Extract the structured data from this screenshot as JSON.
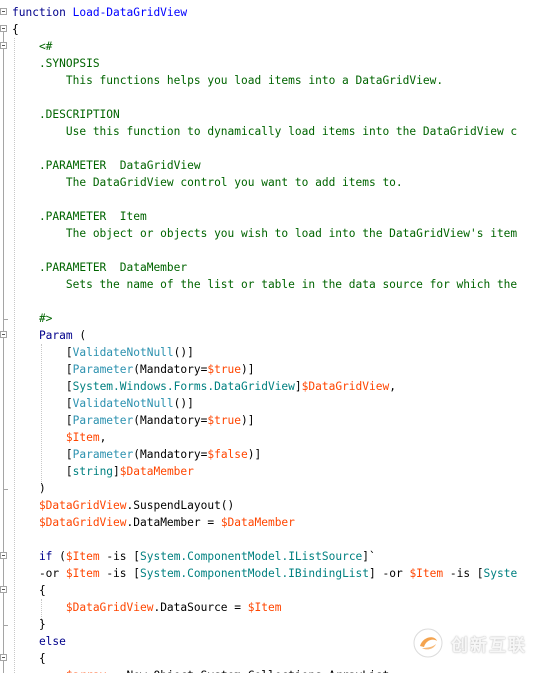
{
  "editor": {
    "lines": [
      [
        {
          "c": "kw",
          "t": "function "
        },
        {
          "c": "fn",
          "t": "Load-DataGridView"
        }
      ],
      [
        {
          "c": "txt",
          "t": "{"
        }
      ],
      [
        {
          "c": "cmt",
          "t": "    <#"
        }
      ],
      [
        {
          "c": "cmt",
          "t": "    .SYNOPSIS"
        }
      ],
      [
        {
          "c": "cmt",
          "t": "        This functions helps you load items into a DataGridView."
        }
      ],
      [
        {
          "c": "txt",
          "t": ""
        }
      ],
      [
        {
          "c": "cmt",
          "t": "    .DESCRIPTION"
        }
      ],
      [
        {
          "c": "cmt",
          "t": "        Use this function to dynamically load items into the DataGridView c"
        }
      ],
      [
        {
          "c": "txt",
          "t": ""
        }
      ],
      [
        {
          "c": "cmt",
          "t": "    .PARAMETER  DataGridView"
        }
      ],
      [
        {
          "c": "cmt",
          "t": "        The DataGridView control you want to add items to."
        }
      ],
      [
        {
          "c": "txt",
          "t": ""
        }
      ],
      [
        {
          "c": "cmt",
          "t": "    .PARAMETER  Item"
        }
      ],
      [
        {
          "c": "cmt",
          "t": "        The object or objects you wish to load into the DataGridView's item"
        }
      ],
      [
        {
          "c": "txt",
          "t": ""
        }
      ],
      [
        {
          "c": "cmt",
          "t": "    .PARAMETER  DataMember"
        }
      ],
      [
        {
          "c": "cmt",
          "t": "        Sets the name of the list or table in the data source for which the"
        }
      ],
      [
        {
          "c": "txt",
          "t": ""
        }
      ],
      [
        {
          "c": "cmt",
          "t": "    #>"
        }
      ],
      [
        {
          "c": "kw",
          "t": "    Param "
        },
        {
          "c": "txt",
          "t": "("
        }
      ],
      [
        {
          "c": "txt",
          "t": "        ["
        },
        {
          "c": "attr",
          "t": "ValidateNotNull"
        },
        {
          "c": "txt",
          "t": "()]"
        }
      ],
      [
        {
          "c": "txt",
          "t": "        ["
        },
        {
          "c": "attr",
          "t": "Parameter"
        },
        {
          "c": "txt",
          "t": "(Mandatory="
        },
        {
          "c": "var",
          "t": "$true"
        },
        {
          "c": "txt",
          "t": ")]"
        }
      ],
      [
        {
          "c": "txt",
          "t": "        ["
        },
        {
          "c": "typ",
          "t": "System.Windows.Forms.DataGridView"
        },
        {
          "c": "txt",
          "t": "]"
        },
        {
          "c": "var",
          "t": "$DataGridView"
        },
        {
          "c": "txt",
          "t": ","
        }
      ],
      [
        {
          "c": "txt",
          "t": "        ["
        },
        {
          "c": "attr",
          "t": "ValidateNotNull"
        },
        {
          "c": "txt",
          "t": "()]"
        }
      ],
      [
        {
          "c": "txt",
          "t": "        ["
        },
        {
          "c": "attr",
          "t": "Parameter"
        },
        {
          "c": "txt",
          "t": "(Mandatory="
        },
        {
          "c": "var",
          "t": "$true"
        },
        {
          "c": "txt",
          "t": ")]"
        }
      ],
      [
        {
          "c": "var",
          "t": "        $Item"
        },
        {
          "c": "txt",
          "t": ","
        }
      ],
      [
        {
          "c": "txt",
          "t": "        ["
        },
        {
          "c": "attr",
          "t": "Parameter"
        },
        {
          "c": "txt",
          "t": "(Mandatory="
        },
        {
          "c": "var",
          "t": "$false"
        },
        {
          "c": "txt",
          "t": ")]"
        }
      ],
      [
        {
          "c": "txt",
          "t": "        ["
        },
        {
          "c": "typ",
          "t": "string"
        },
        {
          "c": "txt",
          "t": "]"
        },
        {
          "c": "var",
          "t": "$DataMember"
        }
      ],
      [
        {
          "c": "txt",
          "t": "    )"
        }
      ],
      [
        {
          "c": "var",
          "t": "    $DataGridView"
        },
        {
          "c": "txt",
          "t": ".SuspendLayout()"
        }
      ],
      [
        {
          "c": "var",
          "t": "    $DataGridView"
        },
        {
          "c": "txt",
          "t": ".DataMember = "
        },
        {
          "c": "var",
          "t": "$DataMember"
        }
      ],
      [
        {
          "c": "txt",
          "t": ""
        }
      ],
      [
        {
          "c": "kw",
          "t": "    if "
        },
        {
          "c": "txt",
          "t": "("
        },
        {
          "c": "var",
          "t": "$Item"
        },
        {
          "c": "txt",
          "t": " -is ["
        },
        {
          "c": "typ",
          "t": "System.ComponentModel.IListSource"
        },
        {
          "c": "txt",
          "t": "]`"
        }
      ],
      [
        {
          "c": "txt",
          "t": "    -or "
        },
        {
          "c": "var",
          "t": "$Item"
        },
        {
          "c": "txt",
          "t": " -is ["
        },
        {
          "c": "typ",
          "t": "System.ComponentModel.IBindingList"
        },
        {
          "c": "txt",
          "t": "] -or "
        },
        {
          "c": "var",
          "t": "$Item"
        },
        {
          "c": "txt",
          "t": " -is ["
        },
        {
          "c": "typ",
          "t": "Syste"
        }
      ],
      [
        {
          "c": "txt",
          "t": "    {"
        }
      ],
      [
        {
          "c": "var",
          "t": "        $DataGridView"
        },
        {
          "c": "txt",
          "t": ".DataSource = "
        },
        {
          "c": "var",
          "t": "$Item"
        }
      ],
      [
        {
          "c": "txt",
          "t": "    }"
        }
      ],
      [
        {
          "c": "kw",
          "t": "    else"
        }
      ],
      [
        {
          "c": "txt",
          "t": "    {"
        }
      ],
      [
        {
          "c": "txt",
          "t": "        "
        },
        {
          "c": "var",
          "t": "$array"
        },
        {
          "c": "txt",
          "t": " = New-Object System.Collections.ArrayList"
        }
      ]
    ]
  },
  "watermark": {
    "text": "创新互联",
    "icon": "brand-swirl-icon"
  }
}
